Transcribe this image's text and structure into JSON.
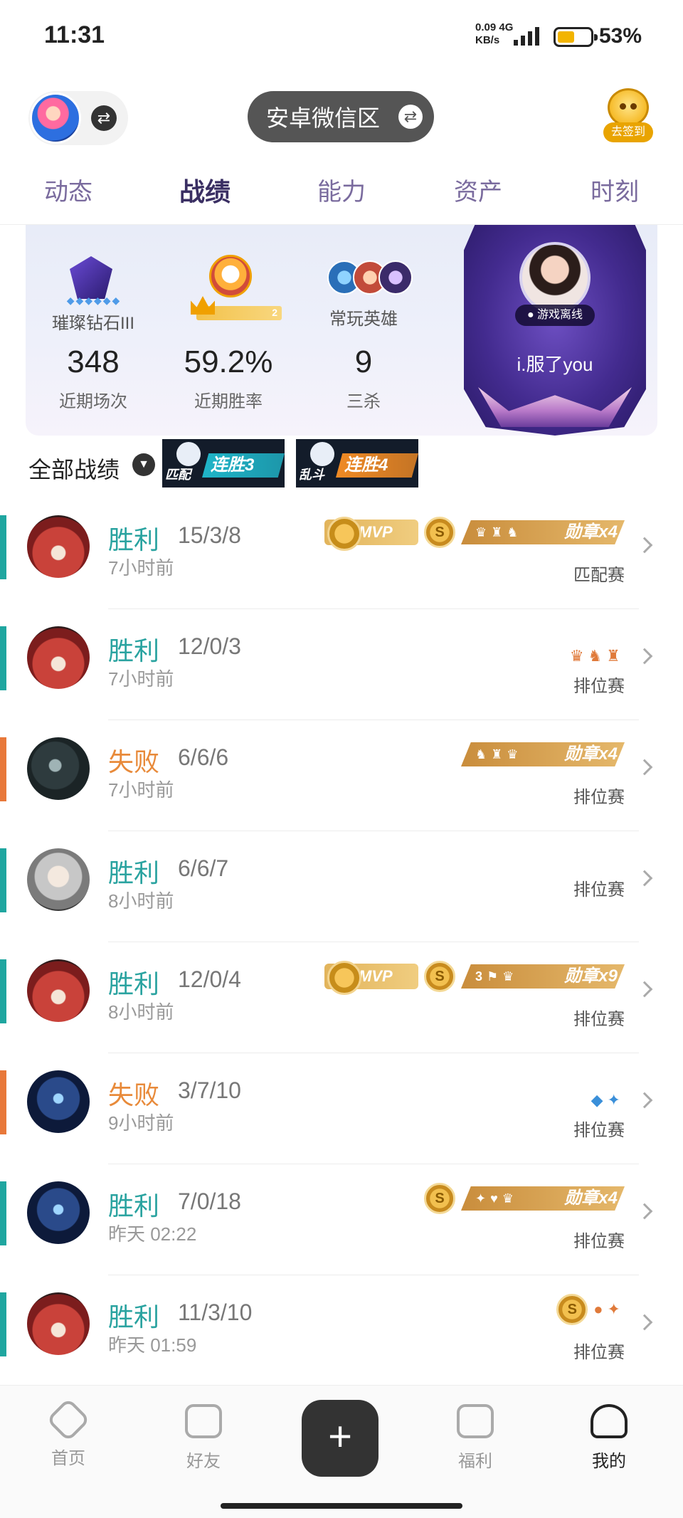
{
  "status_bar": {
    "time": "11:31",
    "net_speed_value": "0.09",
    "net_speed_unit": "KB/s",
    "net_type": "4G",
    "battery_percent": "53%",
    "battery_level": 0.53,
    "battery_color": "#f2b400"
  },
  "header": {
    "region_label": "安卓微信区",
    "signin_label": "去签到"
  },
  "tabs": [
    {
      "label": "动态"
    },
    {
      "label": "战绩"
    },
    {
      "label": "能力"
    },
    {
      "label": "资产"
    },
    {
      "label": "时刻"
    }
  ],
  "summary": {
    "rank": {
      "name": "璀璨钻石III",
      "stars": "◆◆◆◆◆◆",
      "count": "348",
      "count_label": "近期场次"
    },
    "winrate": {
      "crown_level": "2",
      "value": "59.2%",
      "label": "近期胜率"
    },
    "heroes": {
      "label": "常玩英雄",
      "value": "9",
      "value_label": "三杀"
    },
    "profile": {
      "status": "游戏离线",
      "nickname": "i.服了you"
    }
  },
  "filter": {
    "label": "全部战绩",
    "streaks": [
      {
        "mode": "匹配",
        "text": "连胜3",
        "color": "#1fb5c9"
      },
      {
        "mode": "乱斗",
        "text": "连胜4",
        "color": "#f08a24"
      }
    ]
  },
  "matches": [
    {
      "result": "胜利",
      "outcome": "win",
      "kda": "15/3/8",
      "time": "7小时前",
      "mode": "匹配赛",
      "hero": "hero-fox",
      "mvp": "MVP",
      "coin": "S",
      "medal_icons": "♛♜♞",
      "medal": "勋章x4"
    },
    {
      "result": "胜利",
      "outcome": "win",
      "kda": "12/0/3",
      "time": "7小时前",
      "mode": "排位赛",
      "hero": "hero-fox",
      "mini_icons": "♛♞♜"
    },
    {
      "result": "失败",
      "outcome": "loss",
      "kda": "6/6/6",
      "time": "7小时前",
      "mode": "排位赛",
      "hero": "hero-dark",
      "medal_icons": "♞♜♛",
      "medal": "勋章x4"
    },
    {
      "result": "胜利",
      "outcome": "win",
      "kda": "6/6/7",
      "time": "8小时前",
      "mode": "排位赛",
      "hero": "hero-silver"
    },
    {
      "result": "胜利",
      "outcome": "win",
      "kda": "12/0/4",
      "time": "8小时前",
      "mode": "排位赛",
      "hero": "hero-fox",
      "mvp": "MVP",
      "coin": "S",
      "medal_icons": "3⚑♛",
      "medal": "勋章x9"
    },
    {
      "result": "失败",
      "outcome": "loss",
      "kda": "3/7/10",
      "time": "9小时前",
      "mode": "排位赛",
      "hero": "hero-blue",
      "mini_icons": "◆✦"
    },
    {
      "result": "胜利",
      "outcome": "win",
      "kda": "7/0/18",
      "time": "昨天 02:22",
      "mode": "排位赛",
      "hero": "hero-blue",
      "coin": "S",
      "medal_icons": "✦♥♛",
      "medal": "勋章x4"
    },
    {
      "result": "胜利",
      "outcome": "win",
      "kda": "11/3/10",
      "time": "昨天 01:59",
      "mode": "排位赛",
      "hero": "hero-fox",
      "coin": "S",
      "mini_icons": "●✦"
    }
  ],
  "bottom_nav": {
    "home": "首页",
    "friends": "好友",
    "plus": "+",
    "welfare": "福利",
    "me": "我的"
  }
}
